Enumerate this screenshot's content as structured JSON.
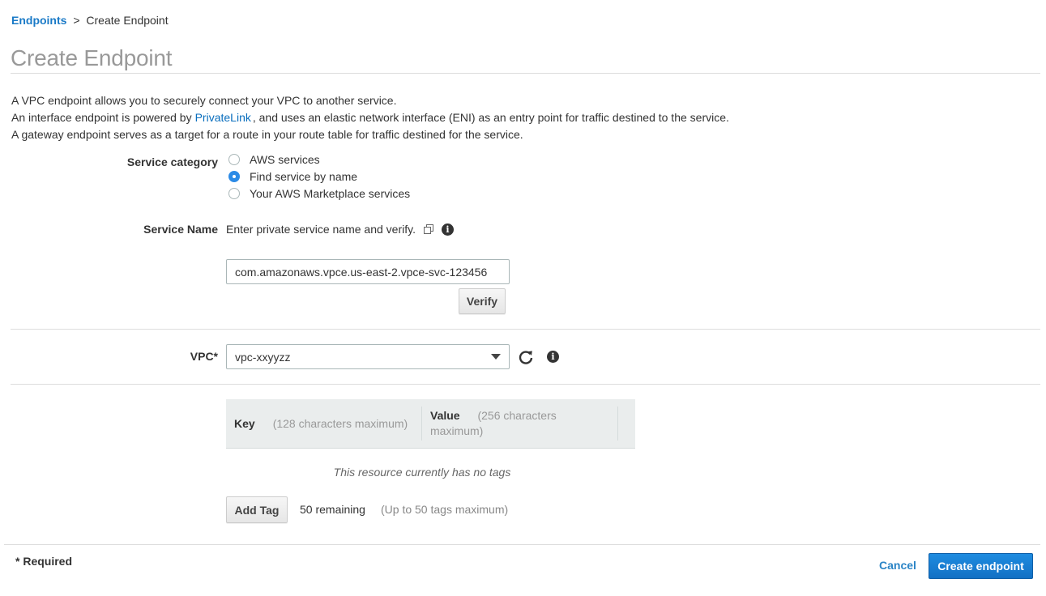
{
  "breadcrumb": {
    "parent": "Endpoints",
    "separator": ">",
    "current": "Create Endpoint"
  },
  "page_title": "Create Endpoint",
  "description": {
    "line1": "A VPC endpoint allows you to securely connect your VPC to another service.",
    "line2_before": "An interface endpoint is powered by",
    "line2_link": "PrivateLink",
    "line2_after": ", and uses an elastic network interface (ENI) as an entry point for traffic destined to the service.",
    "line3": "A gateway endpoint serves as a target for a route in your route table for traffic destined for the service."
  },
  "service_category": {
    "label": "Service category",
    "options": [
      {
        "label": "AWS services",
        "checked": false
      },
      {
        "label": "Find service by name",
        "checked": true
      },
      {
        "label": "Your AWS Marketplace services",
        "checked": false
      }
    ]
  },
  "service_name": {
    "label": "Service Name",
    "hint": "Enter private service name and verify.",
    "value": "com.amazonaws.vpce.us-east-2.vpce-svc-123456",
    "verify_label": "Verify"
  },
  "vpc": {
    "label": "VPC*",
    "selected": "vpc-xxyyzz"
  },
  "tags": {
    "key_header": "Key",
    "key_note": "(128 characters maximum)",
    "value_header": "Value",
    "value_note": "(256 characters maximum)",
    "empty_message": "This resource currently has no tags",
    "add_label": "Add Tag",
    "remaining": "50 remaining",
    "limit_note": "(Up to 50 tags maximum)"
  },
  "footer": {
    "required_note": "* Required",
    "cancel_label": "Cancel",
    "create_label": "Create endpoint"
  },
  "colors": {
    "link": "#1a7ac7",
    "radio_checked": "#2c8be6",
    "primary_button": "#1a7dd6"
  }
}
